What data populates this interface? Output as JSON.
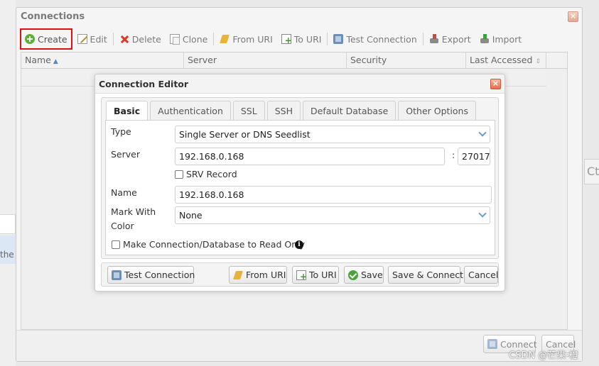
{
  "connections_window": {
    "title": "Connections",
    "close_glyph": "×",
    "toolbar": {
      "create": "Create",
      "edit": "Edit",
      "delete": "Delete",
      "clone": "Clone",
      "from_uri": "From URI",
      "to_uri": "To URI",
      "test_connection": "Test Connection",
      "export": "Export",
      "import": "Import"
    },
    "columns": {
      "name": "Name",
      "server": "Server",
      "security": "Security",
      "last_accessed": "Last Accessed"
    },
    "sort_ascending_glyph": "▲",
    "sortable_glyph": "⇕",
    "footer": {
      "connect": "Connect",
      "cancel": "Cancel"
    }
  },
  "editor": {
    "title": "Connection Editor",
    "close_glyph": "×",
    "tabs": [
      "Basic",
      "Authentication",
      "SSL",
      "SSH",
      "Default Database",
      "Other Options"
    ],
    "active_tab": "Basic",
    "fields": {
      "type_label": "Type",
      "type_value": "Single Server or DNS Seedlist",
      "server_label": "Server",
      "server_host": "192.168.0.168",
      "port_separator": ":",
      "server_port": "27017",
      "srv_record_label": "SRV Record",
      "srv_record_checked": false,
      "name_label": "Name",
      "name_value": "192.168.0.168",
      "mark_color_label_line1": "Mark With",
      "mark_color_label_line2": "Color",
      "mark_color_value": "None",
      "read_only_label": "Make Connection/Database to Read Only",
      "read_only_checked": false,
      "info_glyph": "i"
    },
    "footer": {
      "test_connection": "Test Connection",
      "from_uri": "From URI",
      "to_uri": "To URI",
      "save": "Save",
      "save_connect": "Save & Connect",
      "cancel": "Cancel"
    }
  },
  "background": {
    "left_text": "the",
    "right_text": "Ct"
  },
  "watermark": "CSDN @芒果-橙",
  "colors": {
    "highlight_border": "#e01010",
    "close_button": "#e0704e",
    "accent_blue": "#6a9bd6",
    "success_green": "#4aa33a"
  }
}
